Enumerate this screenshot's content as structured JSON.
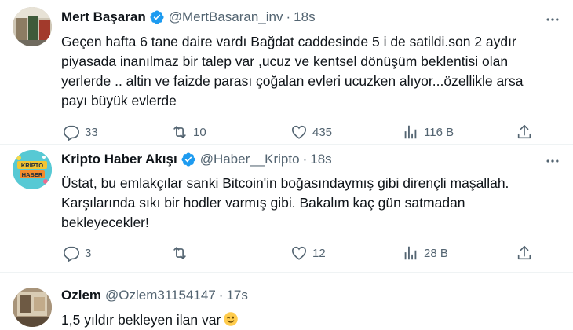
{
  "tweets": [
    {
      "name": "Mert Başaran",
      "handle": "@MertBasaran_inv",
      "time": "18s",
      "verified": true,
      "text": "Geçen hafta 6 tane daire vardı Bağdat caddesinde 5 i de satildi.son 2 aydır\npiyasada inanılmaz bir talep var ,ucuz ve kentsel dönüşüm beklentisi olan\nyerlerde .. altin ve faizde parası çoğalan evleri ucuzken alıyor...özellikle arsa\npayı büyük evlerde",
      "replies": "33",
      "retweets": "10",
      "likes": "435",
      "views": "116 B"
    },
    {
      "name": "Kripto Haber Akışı",
      "handle": "@Haber__Kripto",
      "time": "18s",
      "verified": true,
      "avatar_text": "KRİPTO HABER",
      "text": "Üstat, bu emlakçılar sanki Bitcoin'in boğasındaymış gibi dirençli maşallah.\nKarşılarında sıkı bir hodler varmış gibi. Bakalım kaç gün satmadan\nbekleyecekler!",
      "replies": "3",
      "retweets": "",
      "likes": "12",
      "views": "28 B"
    },
    {
      "name": "Ozlem",
      "handle": "@Ozlem31154147",
      "time": "17s",
      "verified": false,
      "text": "1,5 yıldır bekleyen ilan var"
    }
  ],
  "icons": {
    "reply": "reply-icon",
    "retweet": "retweet-icon",
    "like": "heart-icon",
    "views": "views-icon",
    "share": "share-icon",
    "more": "more-icon",
    "verified": "verified-badge-icon",
    "emoji": "winking-face-emoji"
  },
  "colors": {
    "verified": "#1d9bf0",
    "muted": "#536471",
    "text": "#0f1419",
    "divider": "#eff3f4"
  }
}
